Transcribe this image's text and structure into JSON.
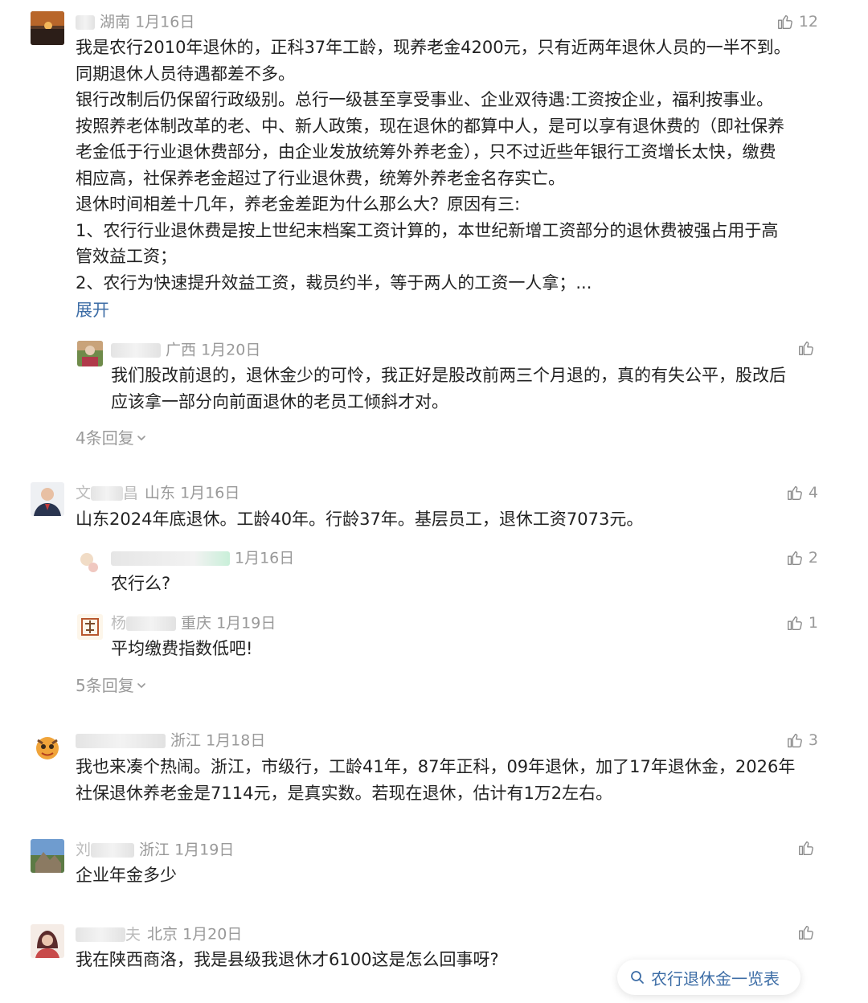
{
  "comments": [
    {
      "location": "湖南",
      "date": "1月16日",
      "likes": "12",
      "lines": [
        "我是农行2010年退休的，正科37年工龄，现养老金4200元，只有近两年退休人员的一半不到。",
        "同期退休人员待遇都差不多。",
        "银行改制后仍保留行政级别。总行一级甚至享受事业、企业双待遇:工资按企业，福利按事业。",
        "按照养老体制改革的老、中、新人政策，现在退休的都算中人，是可以享有退休费的（即社保养",
        "老金低于行业退休费部分，由企业发放统筹外养老金），只不过近些年银行工资增长太快，缴费",
        "相应高，社保养老金超过了行业退休费，统筹外养老金名存实亡。",
        "退休时间相差十几年，养老金差距为什么那么大？原因有三:",
        "1、农行行业退休费是按上世纪末档案工资计算的，本世纪新增工资部分的退休费被强占用于高",
        "管效益工资；",
        "2、农行为快速提升效益工资，裁员约半，等于两人的工资一人拿；..."
      ],
      "expand_label": "展开",
      "reply": {
        "location": "广西",
        "date": "1月20日",
        "lines": [
          "我们股改前退的，退休金少的可怜，我正好是股改前两三个月退的，真的有失公平，股改后",
          "应该拿一部分向前面退休的老员工倾斜才对。"
        ]
      },
      "more_replies": "4条回复"
    },
    {
      "location": "山东",
      "date": "1月16日",
      "likes": "4",
      "name_first": "文",
      "name_last": "昌",
      "text": "山东2024年底退休。工龄40年。行龄37年。基层员工，退休工资7073元。",
      "replies": [
        {
          "date": "1月16日",
          "likes": "2",
          "text": "农行么?"
        },
        {
          "name_first": "杨",
          "location": "重庆",
          "date": "1月19日",
          "likes": "1",
          "text": "平均缴费指数低吧!"
        }
      ],
      "more_replies": "5条回复"
    },
    {
      "location": "浙江",
      "date": "1月18日",
      "likes": "3",
      "lines": [
        "我也来凑个热闹。浙江，市级行，工龄41年，87年正科，09年退休，加了17年退休金，2026年",
        "社保退休养老金是7114元，是真实数。若现在退休，估计有1万2左右。"
      ]
    },
    {
      "name_first": "刘",
      "location": "浙江",
      "date": "1月19日",
      "text": "企业年金多少"
    },
    {
      "name_last": "夫",
      "location": "北京",
      "date": "1月20日",
      "text": "我在陕西商洛，我是县级我退休才6100这是怎么回事呀?"
    }
  ],
  "search": {
    "label": "农行退休金一览表"
  },
  "colors": {
    "link": "#3d6da6",
    "meta": "#999999",
    "text": "#222222"
  }
}
